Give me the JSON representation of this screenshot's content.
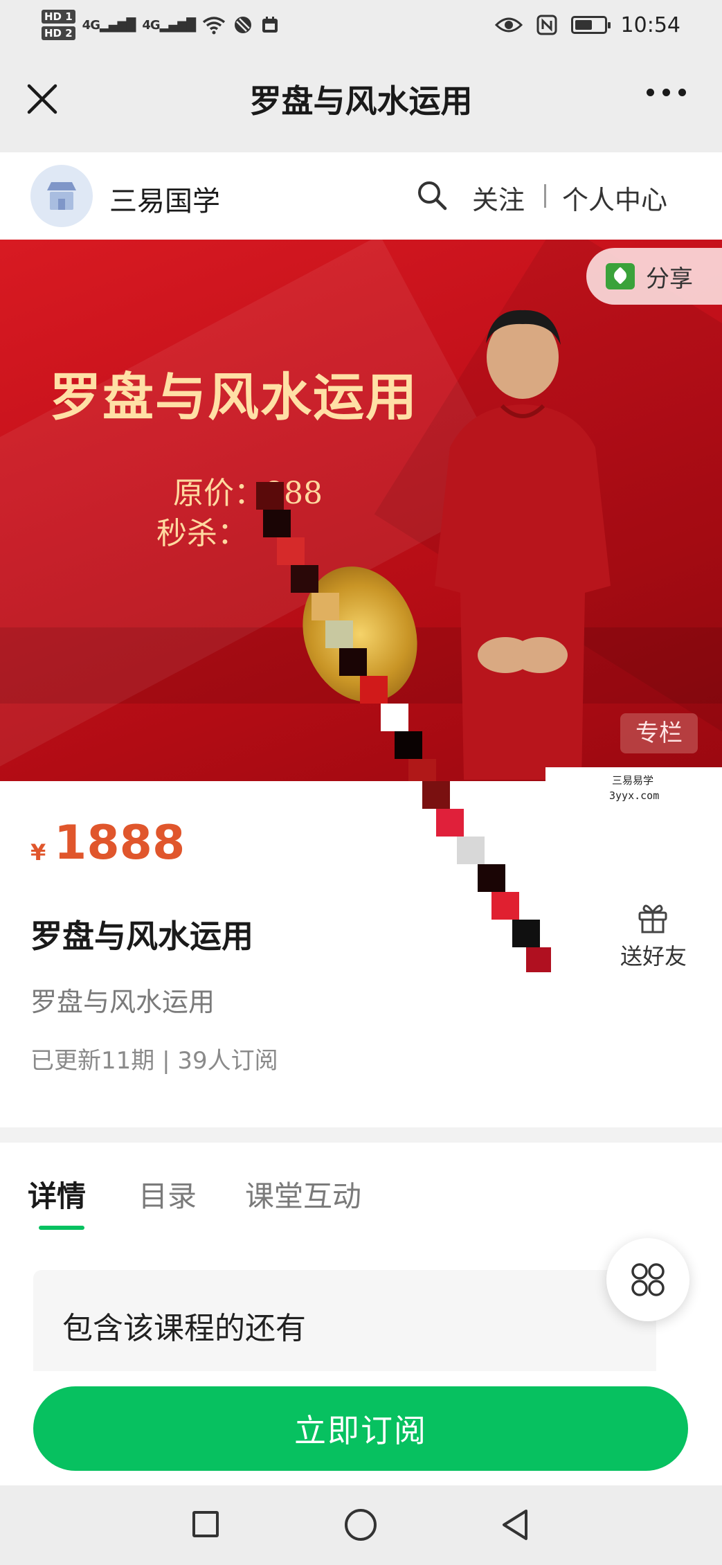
{
  "status_bar": {
    "hd1": "HD 1",
    "hd2": "HD 2",
    "net1": "4G",
    "net2": "4G",
    "time": "10:54",
    "battery_level": 0.6
  },
  "header": {
    "title": "罗盘与风水运用"
  },
  "store": {
    "name": "三易国学",
    "follow_label": "关注",
    "personal_center_label": "个人中心"
  },
  "banner": {
    "title": "罗盘与风水运用",
    "original_price": "原价：888",
    "flash_sale": "秒杀：",
    "share_label": "分享",
    "column_tag": "专栏",
    "watermark_line1": "三易易学",
    "watermark_line2": "3yyx.com"
  },
  "course": {
    "currency": "¥",
    "price": "1888",
    "title": "罗盘与风水运用",
    "subtitle": "罗盘与风水运用",
    "meta": "已更新11期 | 39人订阅",
    "gift_label": "送好友"
  },
  "tabs": [
    {
      "label": "详情",
      "active": true
    },
    {
      "label": "目录",
      "active": false
    },
    {
      "label": "课堂互动",
      "active": false
    }
  ],
  "included": {
    "title": "包含该课程的还有"
  },
  "cta": {
    "label": "立即订阅"
  },
  "colors": {
    "accent_green": "#07c160",
    "price_orange": "#e0562c",
    "banner_red": "#c3101a"
  }
}
